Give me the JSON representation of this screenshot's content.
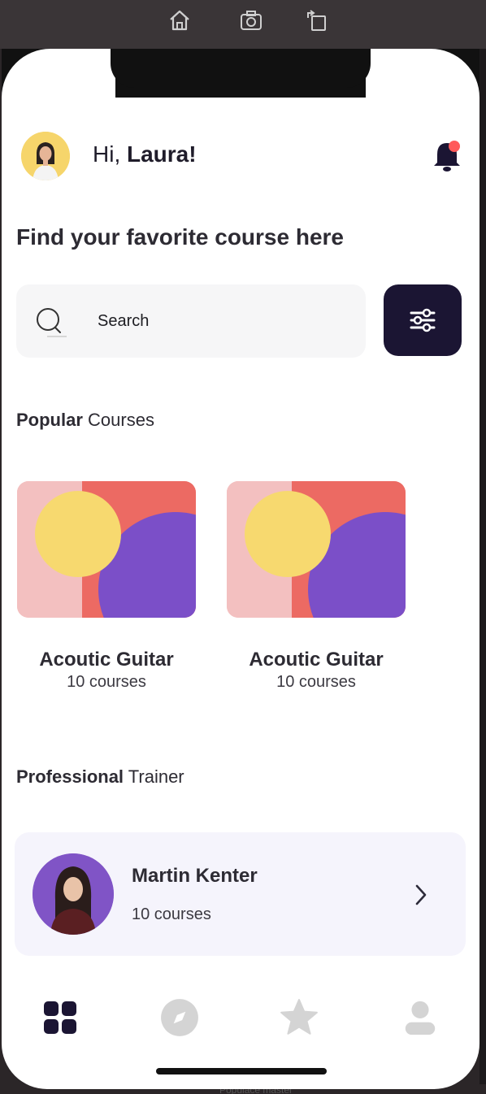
{
  "simulator": {
    "buttons": [
      "home-icon",
      "screenshot-icon",
      "rotate-icon"
    ]
  },
  "header": {
    "greeting_prefix": "Hi, ",
    "user_name": "Laura!",
    "bell_badge_color": "#ff5a5a"
  },
  "page_title": "Find your favorite course here",
  "search": {
    "placeholder": "Search"
  },
  "popular": {
    "title_bold": "Popular",
    "title_light": " Courses",
    "courses": [
      {
        "name": "Acoutic Guitar",
        "count": "10 courses"
      },
      {
        "name": "Acoutic Guitar",
        "count": "10 courses"
      }
    ]
  },
  "trainers": {
    "title_bold": "Professional",
    "title_light": " Trainer",
    "items": [
      {
        "name": "Martin Kenter",
        "count": "10 courses"
      }
    ]
  },
  "nav": {
    "items": [
      "grid-icon",
      "compass-icon",
      "star-icon",
      "profile-icon"
    ],
    "active_color": "#1b1533",
    "inactive_color": "#d4d4d4"
  },
  "colors": {
    "primary_dark": "#1b1533",
    "card_pink": "#f3c0c0",
    "card_red": "#ec6a63",
    "card_purple": "#7b4fc8",
    "card_yellow": "#f7d96f"
  },
  "footer_hint": "Populace    master"
}
